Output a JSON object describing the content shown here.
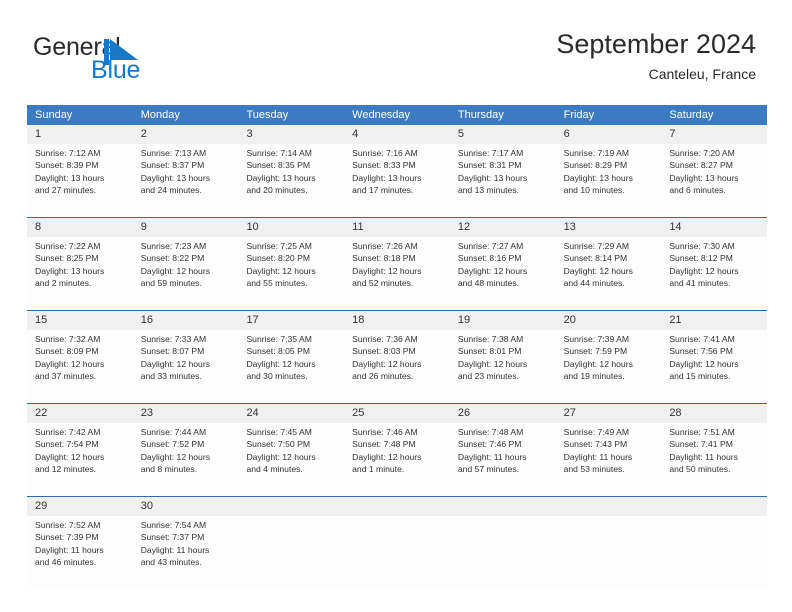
{
  "brand": {
    "name_part1": "General",
    "name_part2": "Blue",
    "mark": "pennant-triangle-icon",
    "color_dark": "#2b2b2b",
    "color_blue": "#1878c8"
  },
  "header": {
    "title": "September 2024",
    "location": "Canteleu, France"
  },
  "theme": {
    "header_band": "#3b7cc0",
    "week_rule": "#2e6da8",
    "daynum_band": "#f0f0f0",
    "cell_bg": "#fdfdfd",
    "text": "#333333"
  },
  "weekdays": [
    "Sunday",
    "Monday",
    "Tuesday",
    "Wednesday",
    "Thursday",
    "Friday",
    "Saturday"
  ],
  "weeks": [
    [
      {
        "day": "1",
        "sunrise": "Sunrise: 7:12 AM",
        "sunset": "Sunset: 8:39 PM",
        "daylight1": "Daylight: 13 hours",
        "daylight2": "and 27 minutes."
      },
      {
        "day": "2",
        "sunrise": "Sunrise: 7:13 AM",
        "sunset": "Sunset: 8:37 PM",
        "daylight1": "Daylight: 13 hours",
        "daylight2": "and 24 minutes."
      },
      {
        "day": "3",
        "sunrise": "Sunrise: 7:14 AM",
        "sunset": "Sunset: 8:35 PM",
        "daylight1": "Daylight: 13 hours",
        "daylight2": "and 20 minutes."
      },
      {
        "day": "4",
        "sunrise": "Sunrise: 7:16 AM",
        "sunset": "Sunset: 8:33 PM",
        "daylight1": "Daylight: 13 hours",
        "daylight2": "and 17 minutes."
      },
      {
        "day": "5",
        "sunrise": "Sunrise: 7:17 AM",
        "sunset": "Sunset: 8:31 PM",
        "daylight1": "Daylight: 13 hours",
        "daylight2": "and 13 minutes."
      },
      {
        "day": "6",
        "sunrise": "Sunrise: 7:19 AM",
        "sunset": "Sunset: 8:29 PM",
        "daylight1": "Daylight: 13 hours",
        "daylight2": "and 10 minutes."
      },
      {
        "day": "7",
        "sunrise": "Sunrise: 7:20 AM",
        "sunset": "Sunset: 8:27 PM",
        "daylight1": "Daylight: 13 hours",
        "daylight2": "and 6 minutes."
      }
    ],
    [
      {
        "day": "8",
        "sunrise": "Sunrise: 7:22 AM",
        "sunset": "Sunset: 8:25 PM",
        "daylight1": "Daylight: 13 hours",
        "daylight2": "and 2 minutes."
      },
      {
        "day": "9",
        "sunrise": "Sunrise: 7:23 AM",
        "sunset": "Sunset: 8:22 PM",
        "daylight1": "Daylight: 12 hours",
        "daylight2": "and 59 minutes."
      },
      {
        "day": "10",
        "sunrise": "Sunrise: 7:25 AM",
        "sunset": "Sunset: 8:20 PM",
        "daylight1": "Daylight: 12 hours",
        "daylight2": "and 55 minutes."
      },
      {
        "day": "11",
        "sunrise": "Sunrise: 7:26 AM",
        "sunset": "Sunset: 8:18 PM",
        "daylight1": "Daylight: 12 hours",
        "daylight2": "and 52 minutes."
      },
      {
        "day": "12",
        "sunrise": "Sunrise: 7:27 AM",
        "sunset": "Sunset: 8:16 PM",
        "daylight1": "Daylight: 12 hours",
        "daylight2": "and 48 minutes."
      },
      {
        "day": "13",
        "sunrise": "Sunrise: 7:29 AM",
        "sunset": "Sunset: 8:14 PM",
        "daylight1": "Daylight: 12 hours",
        "daylight2": "and 44 minutes."
      },
      {
        "day": "14",
        "sunrise": "Sunrise: 7:30 AM",
        "sunset": "Sunset: 8:12 PM",
        "daylight1": "Daylight: 12 hours",
        "daylight2": "and 41 minutes."
      }
    ],
    [
      {
        "day": "15",
        "sunrise": "Sunrise: 7:32 AM",
        "sunset": "Sunset: 8:09 PM",
        "daylight1": "Daylight: 12 hours",
        "daylight2": "and 37 minutes."
      },
      {
        "day": "16",
        "sunrise": "Sunrise: 7:33 AM",
        "sunset": "Sunset: 8:07 PM",
        "daylight1": "Daylight: 12 hours",
        "daylight2": "and 33 minutes."
      },
      {
        "day": "17",
        "sunrise": "Sunrise: 7:35 AM",
        "sunset": "Sunset: 8:05 PM",
        "daylight1": "Daylight: 12 hours",
        "daylight2": "and 30 minutes."
      },
      {
        "day": "18",
        "sunrise": "Sunrise: 7:36 AM",
        "sunset": "Sunset: 8:03 PM",
        "daylight1": "Daylight: 12 hours",
        "daylight2": "and 26 minutes."
      },
      {
        "day": "19",
        "sunrise": "Sunrise: 7:38 AM",
        "sunset": "Sunset: 8:01 PM",
        "daylight1": "Daylight: 12 hours",
        "daylight2": "and 23 minutes."
      },
      {
        "day": "20",
        "sunrise": "Sunrise: 7:39 AM",
        "sunset": "Sunset: 7:59 PM",
        "daylight1": "Daylight: 12 hours",
        "daylight2": "and 19 minutes."
      },
      {
        "day": "21",
        "sunrise": "Sunrise: 7:41 AM",
        "sunset": "Sunset: 7:56 PM",
        "daylight1": "Daylight: 12 hours",
        "daylight2": "and 15 minutes."
      }
    ],
    [
      {
        "day": "22",
        "sunrise": "Sunrise: 7:42 AM",
        "sunset": "Sunset: 7:54 PM",
        "daylight1": "Daylight: 12 hours",
        "daylight2": "and 12 minutes."
      },
      {
        "day": "23",
        "sunrise": "Sunrise: 7:44 AM",
        "sunset": "Sunset: 7:52 PM",
        "daylight1": "Daylight: 12 hours",
        "daylight2": "and 8 minutes."
      },
      {
        "day": "24",
        "sunrise": "Sunrise: 7:45 AM",
        "sunset": "Sunset: 7:50 PM",
        "daylight1": "Daylight: 12 hours",
        "daylight2": "and 4 minutes."
      },
      {
        "day": "25",
        "sunrise": "Sunrise: 7:46 AM",
        "sunset": "Sunset: 7:48 PM",
        "daylight1": "Daylight: 12 hours",
        "daylight2": "and 1 minute."
      },
      {
        "day": "26",
        "sunrise": "Sunrise: 7:48 AM",
        "sunset": "Sunset: 7:46 PM",
        "daylight1": "Daylight: 11 hours",
        "daylight2": "and 57 minutes."
      },
      {
        "day": "27",
        "sunrise": "Sunrise: 7:49 AM",
        "sunset": "Sunset: 7:43 PM",
        "daylight1": "Daylight: 11 hours",
        "daylight2": "and 53 minutes."
      },
      {
        "day": "28",
        "sunrise": "Sunrise: 7:51 AM",
        "sunset": "Sunset: 7:41 PM",
        "daylight1": "Daylight: 11 hours",
        "daylight2": "and 50 minutes."
      }
    ],
    [
      {
        "day": "29",
        "sunrise": "Sunrise: 7:52 AM",
        "sunset": "Sunset: 7:39 PM",
        "daylight1": "Daylight: 11 hours",
        "daylight2": "and 46 minutes."
      },
      {
        "day": "30",
        "sunrise": "Sunrise: 7:54 AM",
        "sunset": "Sunset: 7:37 PM",
        "daylight1": "Daylight: 11 hours",
        "daylight2": "and 43 minutes."
      },
      {
        "day": "",
        "sunrise": "",
        "sunset": "",
        "daylight1": "",
        "daylight2": ""
      },
      {
        "day": "",
        "sunrise": "",
        "sunset": "",
        "daylight1": "",
        "daylight2": ""
      },
      {
        "day": "",
        "sunrise": "",
        "sunset": "",
        "daylight1": "",
        "daylight2": ""
      },
      {
        "day": "",
        "sunrise": "",
        "sunset": "",
        "daylight1": "",
        "daylight2": ""
      },
      {
        "day": "",
        "sunrise": "",
        "sunset": "",
        "daylight1": "",
        "daylight2": ""
      }
    ]
  ]
}
